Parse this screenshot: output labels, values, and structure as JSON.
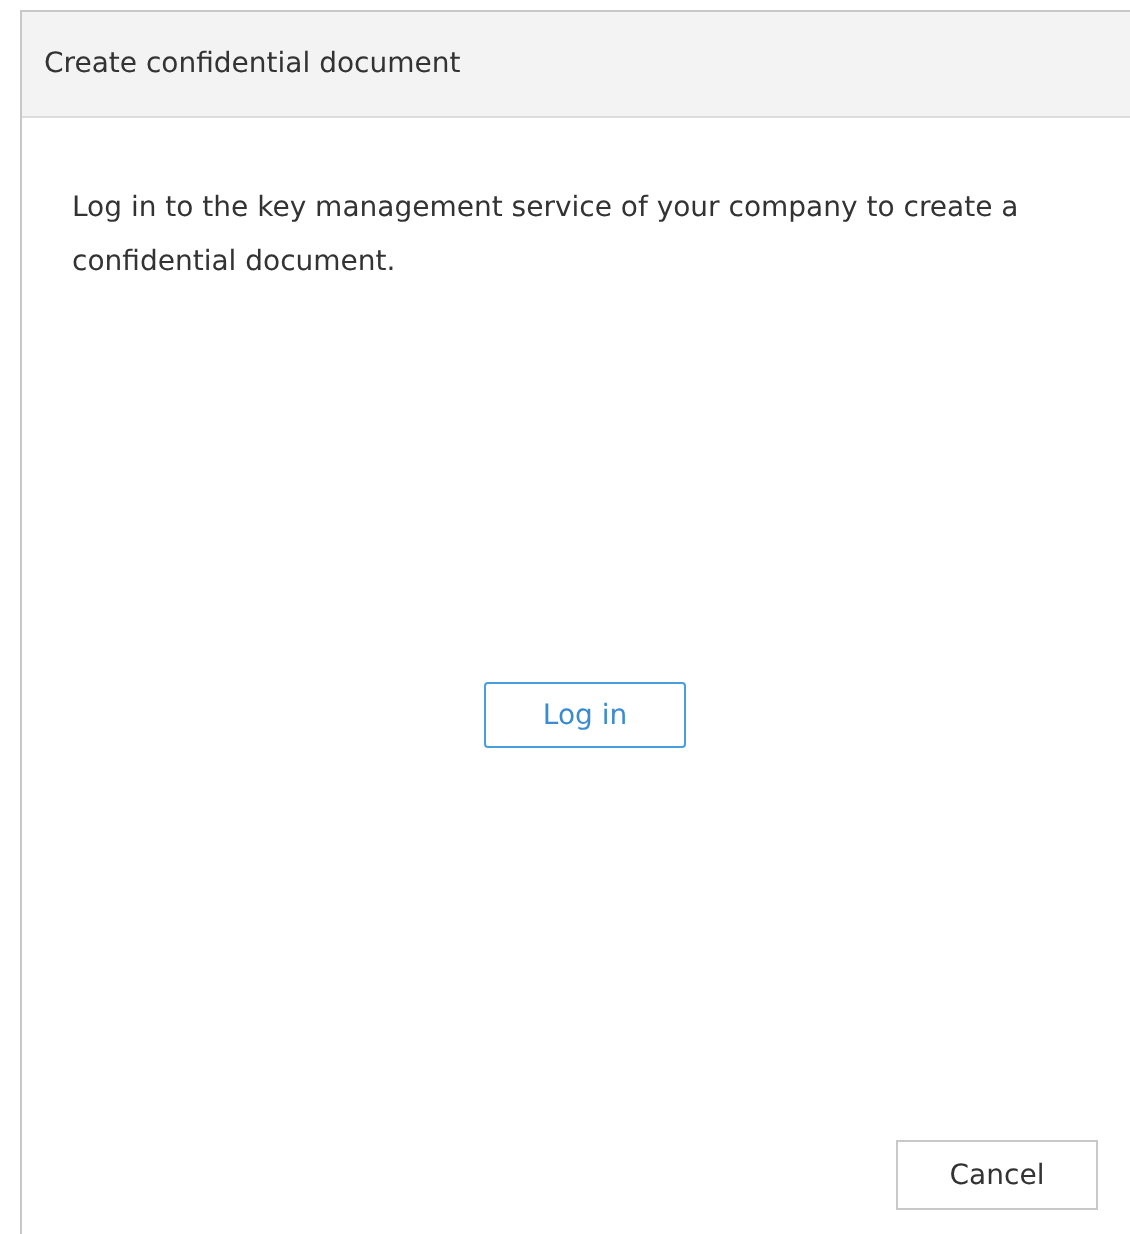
{
  "dialog": {
    "title": "Create confidential document",
    "message": "Log in to the key management service of your company to create a confidential document.",
    "primary_button": "Log in",
    "cancel_button": "Cancel"
  }
}
